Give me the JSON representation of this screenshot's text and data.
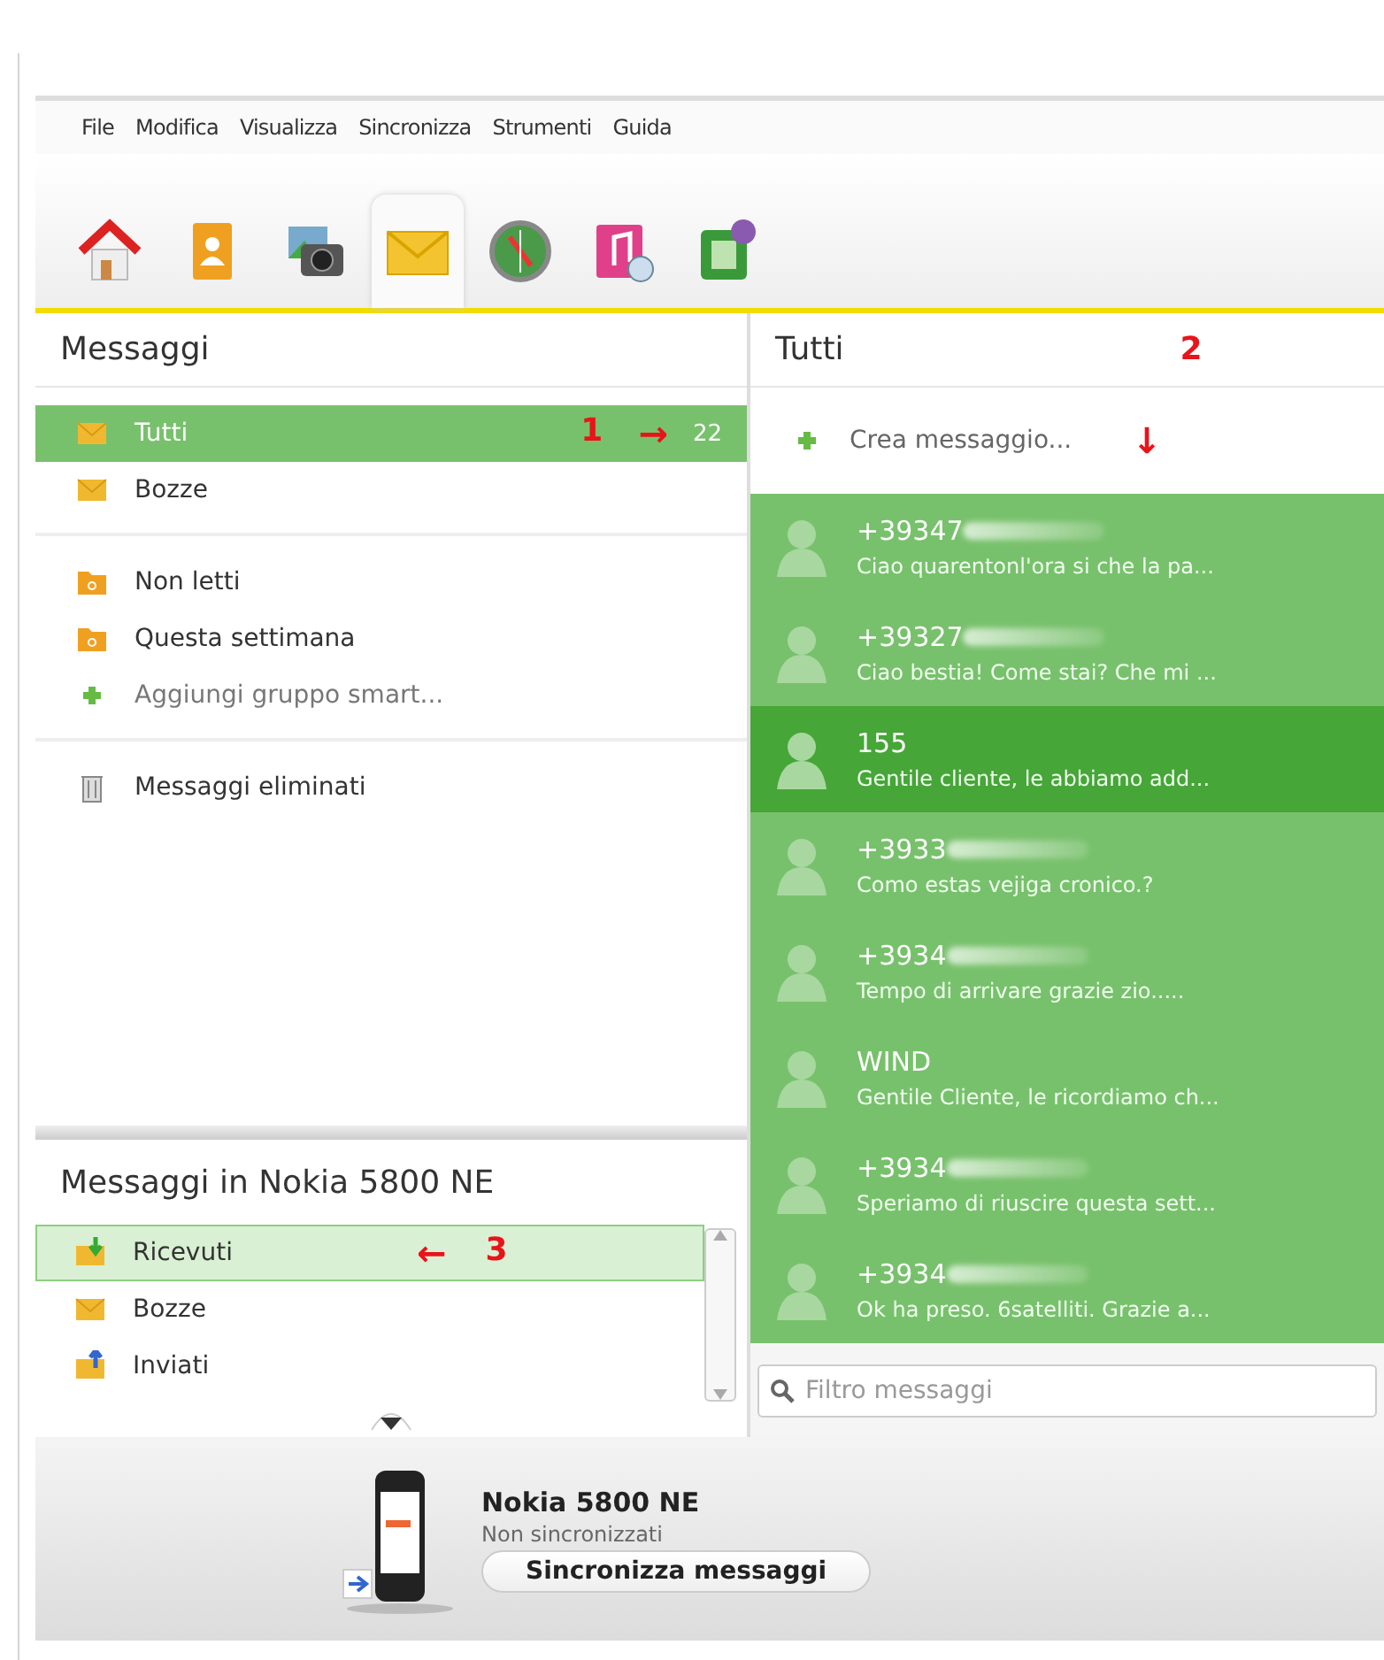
{
  "menu": [
    "File",
    "Modifica",
    "Visualizza",
    "Sincronizza",
    "Strumenti",
    "Guida"
  ],
  "toolbar": [
    {
      "kind": "home",
      "selected": false
    },
    {
      "kind": "contacts",
      "selected": false
    },
    {
      "kind": "photos",
      "selected": false
    },
    {
      "kind": "messages",
      "selected": true
    },
    {
      "kind": "maps",
      "selected": false
    },
    {
      "kind": "music",
      "selected": false
    },
    {
      "kind": "apps",
      "selected": false
    }
  ],
  "folders": {
    "title": "Messaggi",
    "groups": [
      [
        {
          "kind": "envelope",
          "label": "Tutti",
          "count": "22",
          "selected": true,
          "annotation": {
            "number": "1",
            "arrow": "→"
          }
        },
        {
          "kind": "envelope",
          "label": "Bozze",
          "selected": false
        }
      ],
      [
        {
          "kind": "folder",
          "label": "Non letti",
          "selected": false
        },
        {
          "kind": "folder",
          "label": "Questa settimana",
          "selected": false
        },
        {
          "kind": "add",
          "label": "Aggiungi gruppo smart...",
          "selected": false
        }
      ],
      [
        {
          "kind": "trash",
          "label": "Messaggi eliminati",
          "selected": false
        }
      ]
    ]
  },
  "device_folders": {
    "title": "Messaggi in Nokia 5800 NE",
    "items": [
      {
        "kind": "inbox",
        "label": "Ricevuti",
        "selected": true,
        "annotation": {
          "number": "3",
          "arrow": "←"
        }
      },
      {
        "kind": "envelope",
        "label": "Bozze",
        "selected": false
      },
      {
        "kind": "outbox",
        "label": "Inviati",
        "selected": false
      }
    ]
  },
  "conversation_list": {
    "title": "Tutti",
    "annotation": {
      "number": "2",
      "arrow": "↓"
    },
    "new_message": "Crea messaggio...",
    "filter_placeholder": "Filtro messaggi",
    "messages": [
      {
        "sender": "+39347",
        "redacted": true,
        "snippet": "Ciao quarentonl'ora si che la pa...",
        "selected": false
      },
      {
        "sender": "+39327",
        "redacted": true,
        "snippet": "Ciao bestia! Come stai? Che mi ...",
        "selected": false
      },
      {
        "sender": "155",
        "redacted": false,
        "snippet": "Gentile cliente, le abbiamo add...",
        "selected": true
      },
      {
        "sender": "+3933",
        "redacted": true,
        "snippet": "Como  estas vejiga cronico.?",
        "selected": false
      },
      {
        "sender": "+3934",
        "redacted": true,
        "snippet": "Tempo di arrivare grazie zio.....",
        "selected": false
      },
      {
        "sender": "WIND",
        "redacted": false,
        "snippet": "Gentile Cliente, le ricordiamo ch...",
        "selected": false
      },
      {
        "sender": "+3934",
        "redacted": true,
        "snippet": "Speriamo di riuscire questa sett...",
        "selected": false
      },
      {
        "sender": "+3934",
        "redacted": true,
        "snippet": "Ok ha preso. 6satelliti. Grazie a...",
        "selected": false
      }
    ]
  },
  "device": {
    "name": "Nokia 5800 NE",
    "status": "Non sincronizzati",
    "sync_button": "Sincronizza messaggi"
  }
}
